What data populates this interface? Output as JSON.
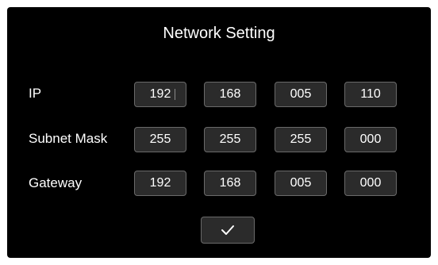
{
  "title": "Network Setting",
  "rows": [
    {
      "label": "IP",
      "values": [
        "192",
        "168",
        "005",
        "110"
      ]
    },
    {
      "label": "Subnet Mask",
      "values": [
        "255",
        "255",
        "255",
        "000"
      ]
    },
    {
      "label": "Gateway",
      "values": [
        "192",
        "168",
        "005",
        "000"
      ]
    }
  ],
  "confirm_icon": "check-icon"
}
